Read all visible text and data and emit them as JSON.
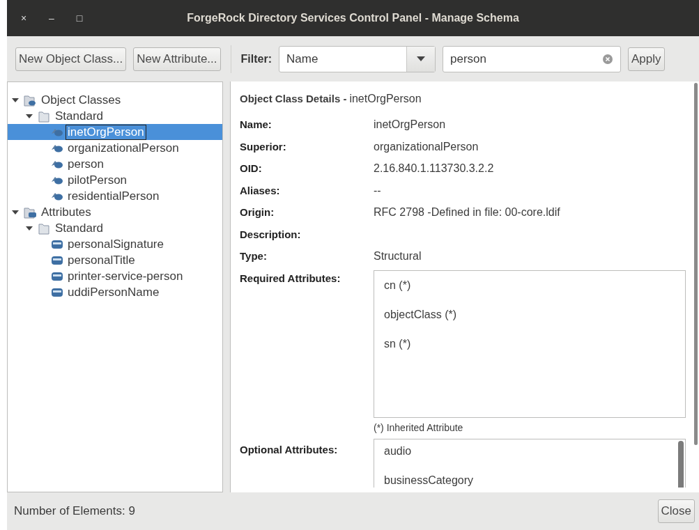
{
  "window": {
    "title": "ForgeRock Directory Services Control Panel - Manage Schema",
    "controls": [
      "×",
      "–",
      "□"
    ]
  },
  "toolbar": {
    "buttons": [
      "New Object Class...",
      "New Attribute..."
    ],
    "filter_label": "Filter:",
    "filter_select": "Name",
    "filter_value": "person",
    "apply": "Apply"
  },
  "tree": [
    {
      "label": "Object Classes",
      "kind": "classes-root",
      "expanded": true,
      "selected": false,
      "children": [
        {
          "label": "Standard",
          "kind": "folder",
          "expanded": true,
          "selected": false,
          "children": [
            {
              "label": "inetOrgPerson",
              "kind": "objectclass",
              "selected": true
            },
            {
              "label": "organizationalPerson",
              "kind": "objectclass",
              "selected": false
            },
            {
              "label": "person",
              "kind": "objectclass",
              "selected": false
            },
            {
              "label": "pilotPerson",
              "kind": "objectclass",
              "selected": false
            },
            {
              "label": "residentialPerson",
              "kind": "objectclass",
              "selected": false
            }
          ]
        }
      ]
    },
    {
      "label": "Attributes",
      "kind": "attributes-root",
      "expanded": true,
      "selected": false,
      "children": [
        {
          "label": "Standard",
          "kind": "folder",
          "expanded": true,
          "selected": false,
          "children": [
            {
              "label": "personalSignature",
              "kind": "attribute",
              "selected": false
            },
            {
              "label": "personalTitle",
              "kind": "attribute",
              "selected": false
            },
            {
              "label": "printer-service-person",
              "kind": "attribute",
              "selected": false
            },
            {
              "label": "uddiPersonName",
              "kind": "attribute",
              "selected": false
            }
          ]
        }
      ]
    }
  ],
  "details": {
    "heading": "Object Class Details - ",
    "heading_name": "inetOrgPerson",
    "fields": [
      {
        "label": "Name:",
        "value": "inetOrgPerson"
      },
      {
        "label": "Superior:",
        "value": "organizationalPerson"
      },
      {
        "label": "OID:",
        "value": "2.16.840.1.113730.3.2.2"
      },
      {
        "label": "Aliases:",
        "value": "--"
      },
      {
        "label": "Origin:",
        "value": "RFC 2798 -Defined in file: 00-core.ldif"
      },
      {
        "label": "Description:"
      },
      {
        "label": "Type:",
        "value": "Structural"
      }
    ],
    "required_label": "Required Attributes:",
    "required": [
      "cn (*)",
      "objectClass (*)",
      "sn (*)"
    ],
    "note": "(*) Inherited Attribute",
    "optional_label": "Optional Attributes:",
    "optional": [
      "audio",
      "businessCategory"
    ]
  },
  "status_bar": {
    "text": "Number of Elements: 9",
    "close": "Close"
  }
}
